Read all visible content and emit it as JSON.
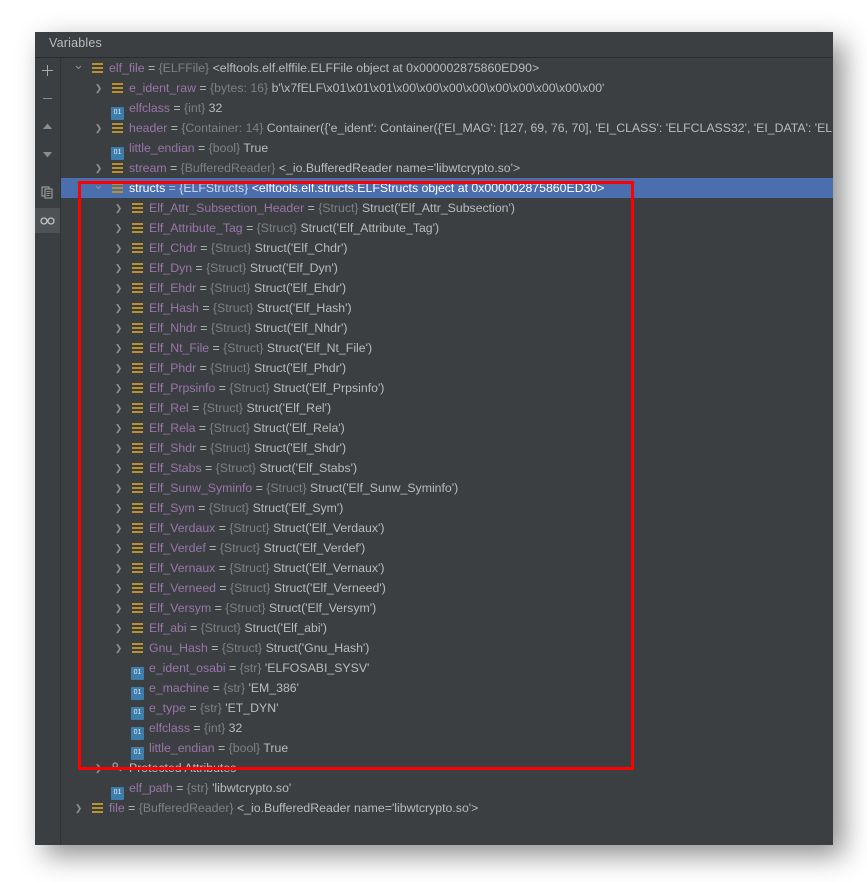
{
  "panel": {
    "tab_label": "Variables",
    "bg_color": "#3c3f41",
    "selection_color": "#4b6eaf",
    "annotation_color": "#ff0000"
  },
  "toolbar": {
    "buttons": [
      {
        "name": "add-button",
        "icon": "plus-icon",
        "glyph": "+",
        "active": false
      },
      {
        "name": "remove-button",
        "icon": "minus-icon",
        "glyph": "–",
        "active": false
      },
      {
        "name": "move-up-button",
        "icon": "arrow-up-icon",
        "glyph": "▲",
        "active": false
      },
      {
        "name": "move-down-button",
        "icon": "arrow-down-icon",
        "glyph": "▼",
        "active": false
      },
      {
        "name": "copy-value-button",
        "icon": "copy-icon",
        "glyph": "⧉",
        "active": false
      },
      {
        "name": "watch-toggle-button",
        "icon": "glasses-icon",
        "glyph": "∞",
        "active": true
      }
    ]
  },
  "tree": {
    "rows": [
      {
        "indent": 0,
        "arrow": "down",
        "icon": "object-icon",
        "name": "elf_file",
        "type": "{ELFFile}",
        "value": "<elftools.elf.elffile.ELFFile object at 0x000002875860ED90>",
        "selected": false
      },
      {
        "indent": 1,
        "arrow": "right",
        "icon": "object-icon",
        "name": "e_ident_raw",
        "type": "{bytes: 16}",
        "value": "b'\\x7fELF\\x01\\x01\\x01\\x00\\x00\\x00\\x00\\x00\\x00\\x00\\x00\\x00'",
        "selected": false
      },
      {
        "indent": 1,
        "arrow": "none",
        "icon": "primitive-icon",
        "name": "elfclass",
        "type": "{int}",
        "value": "32",
        "selected": false
      },
      {
        "indent": 1,
        "arrow": "right",
        "icon": "object-icon",
        "name": "header",
        "type": "{Container: 14}",
        "value": "Container({'e_ident': Container({'EI_MAG': [127, 69, 76, 70], 'EI_CLASS': 'ELFCLASS32', 'EI_DATA': 'ELF",
        "selected": false
      },
      {
        "indent": 1,
        "arrow": "none",
        "icon": "primitive-icon",
        "name": "little_endian",
        "type": "{bool}",
        "value": "True",
        "selected": false
      },
      {
        "indent": 1,
        "arrow": "right",
        "icon": "object-icon",
        "name": "stream",
        "type": "{BufferedReader}",
        "value": "<_io.BufferedReader name='libwtcrypto.so'>",
        "selected": false
      },
      {
        "indent": 1,
        "arrow": "down",
        "icon": "object-icon",
        "name": "structs",
        "type": "{ELFStructs}",
        "value": "<elftools.elf.structs.ELFStructs object at 0x000002875860ED30>",
        "selected": true
      },
      {
        "indent": 2,
        "arrow": "right",
        "icon": "object-icon",
        "name": "Elf_Attr_Subsection_Header",
        "type": "{Struct}",
        "value": "Struct('Elf_Attr_Subsection')",
        "selected": false
      },
      {
        "indent": 2,
        "arrow": "right",
        "icon": "object-icon",
        "name": "Elf_Attribute_Tag",
        "type": "{Struct}",
        "value": "Struct('Elf_Attribute_Tag')",
        "selected": false
      },
      {
        "indent": 2,
        "arrow": "right",
        "icon": "object-icon",
        "name": "Elf_Chdr",
        "type": "{Struct}",
        "value": "Struct('Elf_Chdr')",
        "selected": false
      },
      {
        "indent": 2,
        "arrow": "right",
        "icon": "object-icon",
        "name": "Elf_Dyn",
        "type": "{Struct}",
        "value": "Struct('Elf_Dyn')",
        "selected": false
      },
      {
        "indent": 2,
        "arrow": "right",
        "icon": "object-icon",
        "name": "Elf_Ehdr",
        "type": "{Struct}",
        "value": "Struct('Elf_Ehdr')",
        "selected": false
      },
      {
        "indent": 2,
        "arrow": "right",
        "icon": "object-icon",
        "name": "Elf_Hash",
        "type": "{Struct}",
        "value": "Struct('Elf_Hash')",
        "selected": false
      },
      {
        "indent": 2,
        "arrow": "right",
        "icon": "object-icon",
        "name": "Elf_Nhdr",
        "type": "{Struct}",
        "value": "Struct('Elf_Nhdr')",
        "selected": false
      },
      {
        "indent": 2,
        "arrow": "right",
        "icon": "object-icon",
        "name": "Elf_Nt_File",
        "type": "{Struct}",
        "value": "Struct('Elf_Nt_File')",
        "selected": false
      },
      {
        "indent": 2,
        "arrow": "right",
        "icon": "object-icon",
        "name": "Elf_Phdr",
        "type": "{Struct}",
        "value": "Struct('Elf_Phdr')",
        "selected": false
      },
      {
        "indent": 2,
        "arrow": "right",
        "icon": "object-icon",
        "name": "Elf_Prpsinfo",
        "type": "{Struct}",
        "value": "Struct('Elf_Prpsinfo')",
        "selected": false
      },
      {
        "indent": 2,
        "arrow": "right",
        "icon": "object-icon",
        "name": "Elf_Rel",
        "type": "{Struct}",
        "value": "Struct('Elf_Rel')",
        "selected": false
      },
      {
        "indent": 2,
        "arrow": "right",
        "icon": "object-icon",
        "name": "Elf_Rela",
        "type": "{Struct}",
        "value": "Struct('Elf_Rela')",
        "selected": false
      },
      {
        "indent": 2,
        "arrow": "right",
        "icon": "object-icon",
        "name": "Elf_Shdr",
        "type": "{Struct}",
        "value": "Struct('Elf_Shdr')",
        "selected": false
      },
      {
        "indent": 2,
        "arrow": "right",
        "icon": "object-icon",
        "name": "Elf_Stabs",
        "type": "{Struct}",
        "value": "Struct('Elf_Stabs')",
        "selected": false
      },
      {
        "indent": 2,
        "arrow": "right",
        "icon": "object-icon",
        "name": "Elf_Sunw_Syminfo",
        "type": "{Struct}",
        "value": "Struct('Elf_Sunw_Syminfo')",
        "selected": false
      },
      {
        "indent": 2,
        "arrow": "right",
        "icon": "object-icon",
        "name": "Elf_Sym",
        "type": "{Struct}",
        "value": "Struct('Elf_Sym')",
        "selected": false
      },
      {
        "indent": 2,
        "arrow": "right",
        "icon": "object-icon",
        "name": "Elf_Verdaux",
        "type": "{Struct}",
        "value": "Struct('Elf_Verdaux')",
        "selected": false
      },
      {
        "indent": 2,
        "arrow": "right",
        "icon": "object-icon",
        "name": "Elf_Verdef",
        "type": "{Struct}",
        "value": "Struct('Elf_Verdef')",
        "selected": false
      },
      {
        "indent": 2,
        "arrow": "right",
        "icon": "object-icon",
        "name": "Elf_Vernaux",
        "type": "{Struct}",
        "value": "Struct('Elf_Vernaux')",
        "selected": false
      },
      {
        "indent": 2,
        "arrow": "right",
        "icon": "object-icon",
        "name": "Elf_Verneed",
        "type": "{Struct}",
        "value": "Struct('Elf_Verneed')",
        "selected": false
      },
      {
        "indent": 2,
        "arrow": "right",
        "icon": "object-icon",
        "name": "Elf_Versym",
        "type": "{Struct}",
        "value": "Struct('Elf_Versym')",
        "selected": false
      },
      {
        "indent": 2,
        "arrow": "right",
        "icon": "object-icon",
        "name": "Elf_abi",
        "type": "{Struct}",
        "value": "Struct('Elf_abi')",
        "selected": false
      },
      {
        "indent": 2,
        "arrow": "right",
        "icon": "object-icon",
        "name": "Gnu_Hash",
        "type": "{Struct}",
        "value": "Struct('Gnu_Hash')",
        "selected": false
      },
      {
        "indent": 2,
        "arrow": "none",
        "icon": "primitive-icon",
        "name": "e_ident_osabi",
        "type": "{str}",
        "value": "'ELFOSABI_SYSV'",
        "selected": false
      },
      {
        "indent": 2,
        "arrow": "none",
        "icon": "primitive-icon",
        "name": "e_machine",
        "type": "{str}",
        "value": "'EM_386'",
        "selected": false
      },
      {
        "indent": 2,
        "arrow": "none",
        "icon": "primitive-icon",
        "name": "e_type",
        "type": "{str}",
        "value": "'ET_DYN'",
        "selected": false
      },
      {
        "indent": 2,
        "arrow": "none",
        "icon": "primitive-icon",
        "name": "elfclass",
        "type": "{int}",
        "value": "32",
        "selected": false
      },
      {
        "indent": 2,
        "arrow": "none",
        "icon": "primitive-icon",
        "name": "little_endian",
        "type": "{bool}",
        "value": "True",
        "selected": false
      },
      {
        "indent": 1,
        "arrow": "right",
        "icon": "key-icon",
        "name": "Protected Attributes",
        "type": "",
        "value": "",
        "selected": false,
        "plain": true
      },
      {
        "indent": 1,
        "arrow": "none",
        "icon": "primitive-icon",
        "name": "elf_path",
        "type": "{str}",
        "value": "'libwtcrypto.so'",
        "selected": false
      },
      {
        "indent": 0,
        "arrow": "right",
        "icon": "object-icon",
        "name": "file",
        "type": "{BufferedReader}",
        "value": "<_io.BufferedReader name='libwtcrypto.so'>",
        "selected": false
      }
    ]
  }
}
